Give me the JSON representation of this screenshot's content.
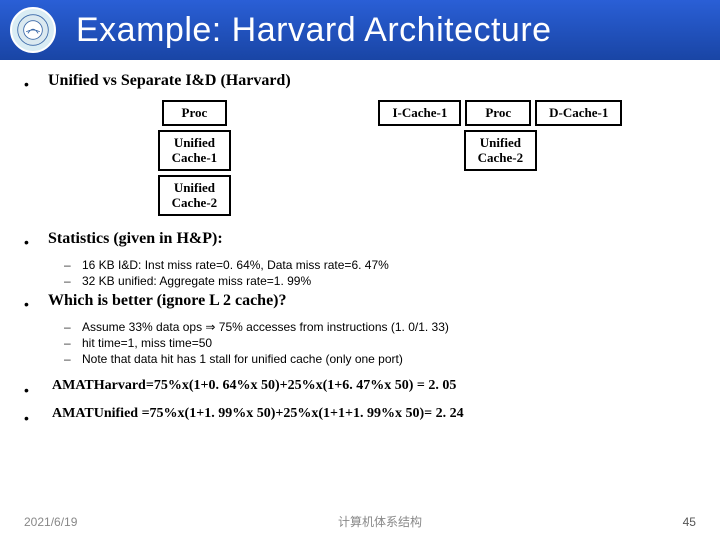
{
  "header": {
    "title": "Example: Harvard Architecture"
  },
  "section1": {
    "heading": "Unified vs Separate I&D (Harvard)"
  },
  "diagram": {
    "unified": {
      "proc": "Proc",
      "l1": "Unified\nCache-1",
      "l2": "Unified\nCache-2"
    },
    "harvard": {
      "icache": "I-Cache-1",
      "proc": "Proc",
      "dcache": "D-Cache-1",
      "l2": "Unified\nCache-2"
    }
  },
  "section2": {
    "heading": "Statistics (given in H&P):",
    "sub1": "16 KB I&D: Inst miss rate=0. 64%, Data miss rate=6. 47%",
    "sub2": "32 KB unified: Aggregate miss rate=1. 99%"
  },
  "section3": {
    "heading": "Which is better (ignore L 2 cache)?",
    "sub1": "Assume 33% data ops ⇒ 75% accesses from instructions (1. 0/1. 33)",
    "sub2": "hit time=1, miss time=50",
    "sub3": "Note that data hit has 1 stall for unified cache (only one port)"
  },
  "equations": {
    "e1": "AMATHarvard=75%x(1+0. 64%x 50)+25%x(1+6. 47%x 50) =  2. 05",
    "e2": "AMATUnified =75%x(1+1. 99%x 50)+25%x(1+1+1. 99%x 50)= 2. 24"
  },
  "footer": {
    "date": "2021/6/19",
    "center": "计算机体系结构",
    "page": "45"
  }
}
